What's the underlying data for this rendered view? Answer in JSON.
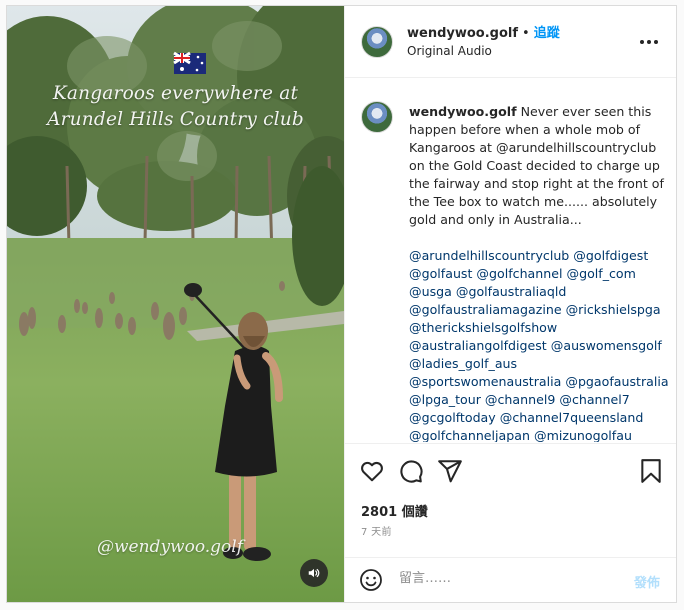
{
  "media": {
    "overlay_title": [
      "Kangaroos everywhere at",
      "Arundel Hills Country club"
    ],
    "watermark": "@wendywoo.golf",
    "audio_icon": "speaker-icon"
  },
  "header": {
    "username": "wendywoo.golf",
    "dot": "•",
    "follow_label": "追蹤",
    "audio_label": "Original Audio",
    "more_icon": "more-options-icon"
  },
  "caption": {
    "username": "wendywoo.golf",
    "text": "Never ever seen this happen before when a whole mob of Kangaroos at @arundelhillscountryclub on the Gold Coast decided to charge up the fairway and stop right at the front of the Tee box to watch me...... absolutely gold and only in Australia...",
    "hashtags": "@arundelhillscountryclub @golfdigest @golfaust @golfchannel @golf_com @usga @golfaustraliaqld @golfaustraliamagazine @rickshielspga @therickshielsgolfshow @australiangolfdigest @auswomensgolf @ladies_golf_aus @sportswomenaustralia @pgaofaustralia @lpga_tour @channel9 @channel7 @gcgolftoday @channel7queensland @golfchanneljapan @mizunogolfau"
  },
  "actions": {
    "icons": [
      "heart-icon",
      "comment-icon",
      "share-icon",
      "bookmark-icon"
    ],
    "views": "2801 個讚",
    "time": "7 天前"
  },
  "comment": {
    "emoji_icon": "emoji-icon",
    "placeholder": "留言……",
    "post_label": "發佈"
  },
  "colors": {
    "follow": "#0095f6",
    "post_disabled": "#b2dffc",
    "text": "#262626",
    "secondary": "#8e8e8e"
  }
}
